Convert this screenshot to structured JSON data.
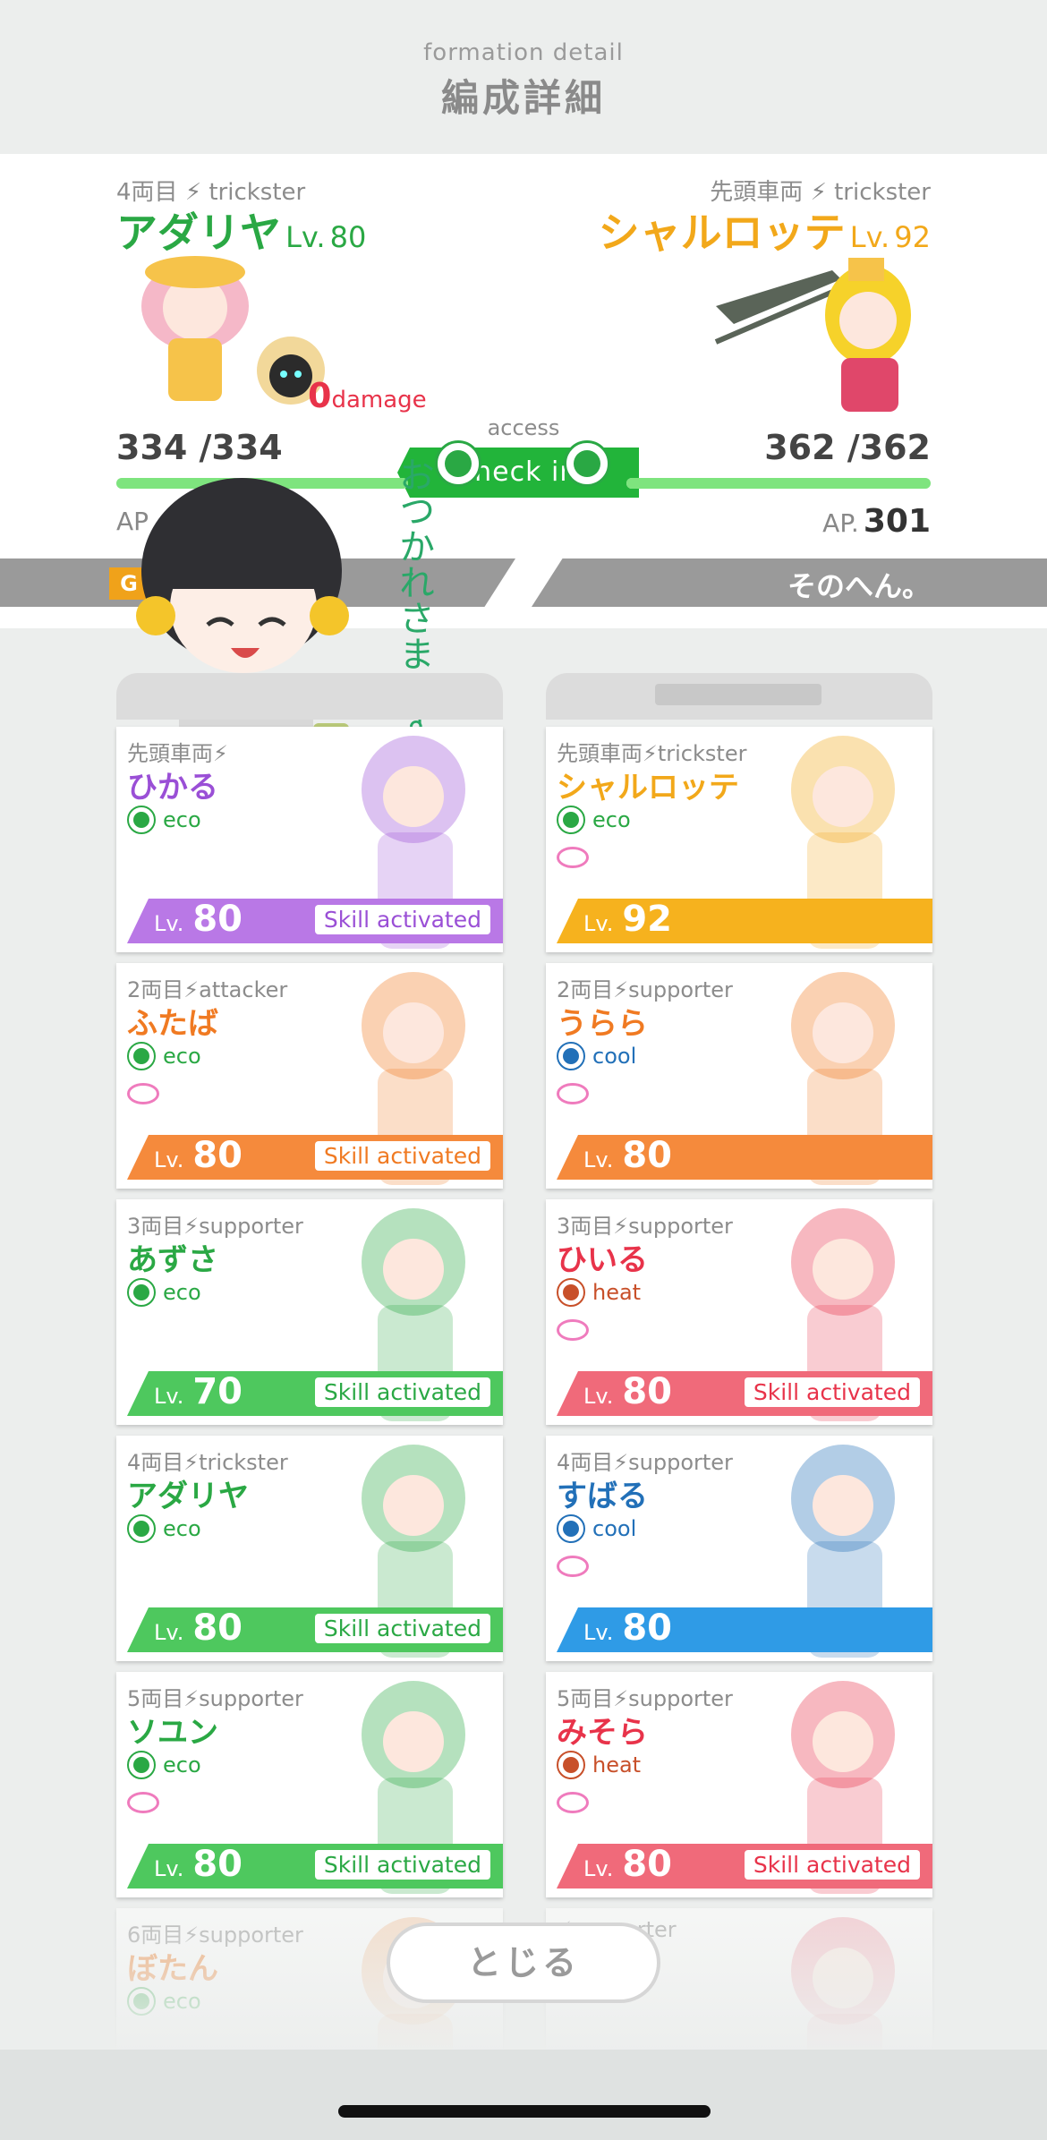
{
  "header": {
    "subtitle": "formation detail",
    "title": "編成詳細"
  },
  "battle": {
    "left": {
      "position": "4両目",
      "role": "trickster",
      "name": "アダリヤ",
      "level_prefix": "Lv.",
      "level": "80",
      "hp": "334 /334",
      "hp_fraction": 1.0,
      "ap_label": "AP",
      "damage_value": "0",
      "damage_label": "damage",
      "band_text": "G"
    },
    "right": {
      "position": "先頭車両",
      "role": "trickster",
      "name": "シャルロッテ",
      "level_prefix": "Lv.",
      "level": "92",
      "hp": "362 /362",
      "hp_fraction": 1.0,
      "ap_label": "AP.",
      "ap_value": "301",
      "band_text": "そのへん。"
    },
    "access_label": "access",
    "checkin_label": "check in",
    "mascot_message": "おつかれさまです♪"
  },
  "left_cards": [
    {
      "position": "先頭車両",
      "role": "",
      "name": "ひかる",
      "name_color": "#9a4fd6",
      "attr": "eco",
      "level": "80",
      "bar_color": "#b978e6",
      "skill": "Skill activated",
      "skill_color": "#9a4fd6",
      "heart": false
    },
    {
      "position": "2両目",
      "role": "attacker",
      "name": "ふたば",
      "name_color": "#f07a22",
      "attr": "eco",
      "level": "80",
      "bar_color": "#f58a3c",
      "skill": "Skill activated",
      "skill_color": "#f07a22",
      "heart": true
    },
    {
      "position": "3両目",
      "role": "supporter",
      "name": "あずさ",
      "name_color": "#2aa844",
      "attr": "eco",
      "level": "70",
      "bar_color": "#4ec85e",
      "skill": "Skill activated",
      "skill_color": "#2aa844",
      "heart": false
    },
    {
      "position": "4両目",
      "role": "trickster",
      "name": "アダリヤ",
      "name_color": "#2aa844",
      "attr": "eco",
      "level": "80",
      "bar_color": "#4ec85e",
      "skill": "Skill activated",
      "skill_color": "#2aa844",
      "heart": false
    },
    {
      "position": "5両目",
      "role": "supporter",
      "name": "ソユン",
      "name_color": "#2aa844",
      "attr": "eco",
      "level": "80",
      "bar_color": "#4ec85e",
      "skill": "Skill activated",
      "skill_color": "#2aa844",
      "heart": true
    },
    {
      "position": "6両目",
      "role": "supporter",
      "name": "ぼたん",
      "name_color": "#f07a22",
      "attr": "eco",
      "level": "",
      "bar_color": "",
      "skill": "",
      "skill_color": "",
      "heart": false
    }
  ],
  "right_cards": [
    {
      "position": "先頭車両",
      "role": "trickster",
      "name": "シャルロッテ",
      "name_color": "#f2a81a",
      "attr": "eco",
      "level": "92",
      "bar_color": "#f6b21e",
      "skill": "",
      "skill_color": "",
      "heart": true
    },
    {
      "position": "2両目",
      "role": "supporter",
      "name": "うらら",
      "name_color": "#f07a22",
      "attr": "cool",
      "level": "80",
      "bar_color": "#f58a3c",
      "skill": "",
      "skill_color": "",
      "heart": true
    },
    {
      "position": "3両目",
      "role": "supporter",
      "name": "ひいる",
      "name_color": "#e8334a",
      "attr": "heat",
      "level": "80",
      "bar_color": "#f06a7a",
      "skill": "Skill activated",
      "skill_color": "#e8334a",
      "heart": true
    },
    {
      "position": "4両目",
      "role": "supporter",
      "name": "すばる",
      "name_color": "#2270b8",
      "attr": "cool",
      "level": "80",
      "bar_color": "#2f9be6",
      "skill": "",
      "skill_color": "",
      "heart": true
    },
    {
      "position": "5両目",
      "role": "supporter",
      "name": "みそら",
      "name_color": "#e8334a",
      "attr": "heat",
      "level": "80",
      "bar_color": "#f06a7a",
      "skill": "Skill activated",
      "skill_color": "#e8334a",
      "heart": true
    },
    {
      "position": "",
      "role": "supporter",
      "name": "",
      "name_color": "#e8334a",
      "attr": "",
      "level": "",
      "bar_color": "",
      "skill": "",
      "skill_color": "",
      "heart": false
    }
  ],
  "attr_colors": {
    "eco": "#2aa844",
    "cool": "#2270b8",
    "heat": "#c8502a"
  },
  "icons": {
    "bolt": "lightning-bolt-icon",
    "heart": "heart-ring-icon"
  },
  "footer": {
    "close_label": "とじる"
  }
}
